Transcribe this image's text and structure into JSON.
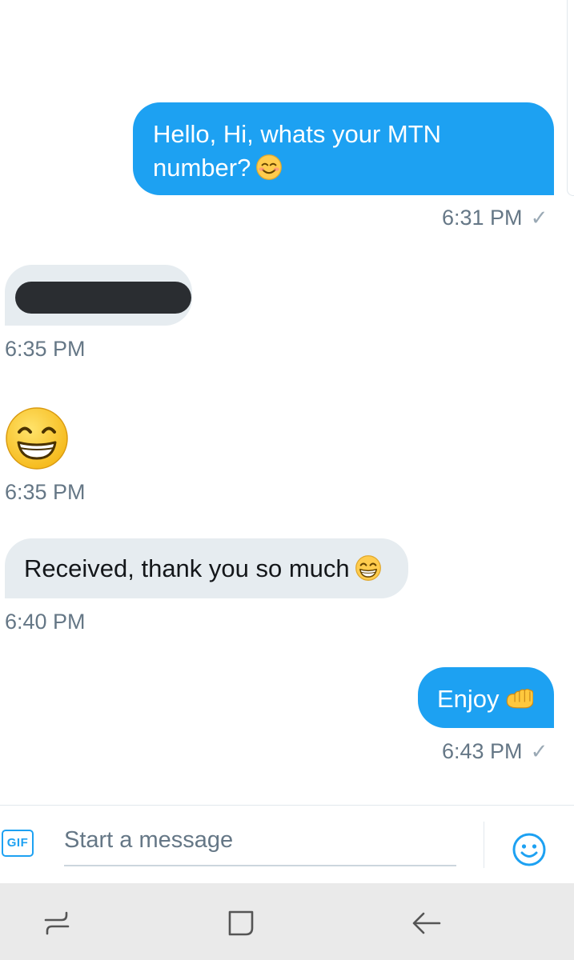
{
  "messages": [
    {
      "direction": "sent",
      "text": "Hello, Hi, whats your MTN",
      "text_line2": "number?",
      "emoji": "smiling-face-icon",
      "time": "6:31 PM",
      "status": "sent-check"
    },
    {
      "direction": "received",
      "content": "redacted-phone-number",
      "time": "6:35 PM"
    },
    {
      "direction": "received",
      "emoji": "grinning-face-icon",
      "time": "6:35 PM"
    },
    {
      "direction": "received",
      "text": "Received, thank you so much",
      "emoji": "grinning-face-icon",
      "time": "6:40 PM"
    },
    {
      "direction": "sent",
      "text": "Enjoy",
      "emoji": "fist-bump-icon",
      "time": "6:43 PM",
      "status": "sent-check"
    }
  ],
  "composer": {
    "gif_label": "GIF",
    "placeholder": "Start a message",
    "value": "",
    "emoji_icon": "smiley-icon"
  },
  "navbar": {
    "icons": [
      "recent-apps-icon",
      "home-icon",
      "back-icon"
    ]
  },
  "colors": {
    "accent": "#1da1f2",
    "received_bubble": "#e6ecf0",
    "meta_text": "#657786",
    "navbar_bg": "#eaeaea"
  }
}
